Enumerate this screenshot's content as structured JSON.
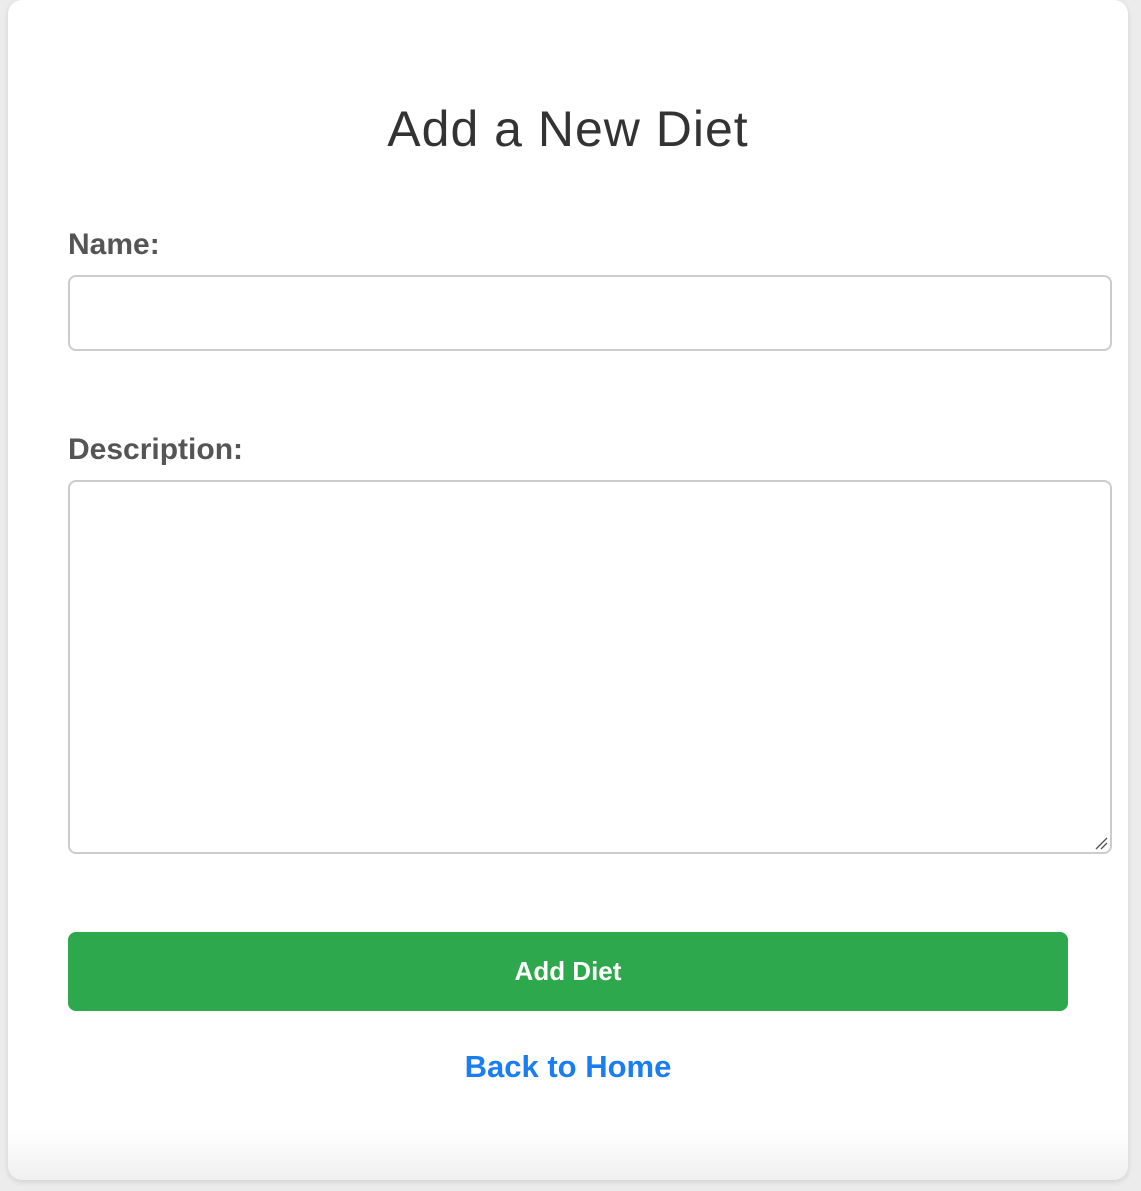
{
  "page": {
    "title": "Add a New Diet"
  },
  "form": {
    "name_label": "Name:",
    "name_value": "",
    "description_label": "Description:",
    "description_value": "",
    "submit_label": "Add Diet"
  },
  "nav": {
    "back_label": "Back to Home"
  },
  "colors": {
    "primary_button": "#2ea84c",
    "link": "#1a7ef2",
    "title_text": "#333333",
    "label_text": "#555555"
  },
  "icons": {
    "resize_handle": "resize-grip-icon"
  }
}
